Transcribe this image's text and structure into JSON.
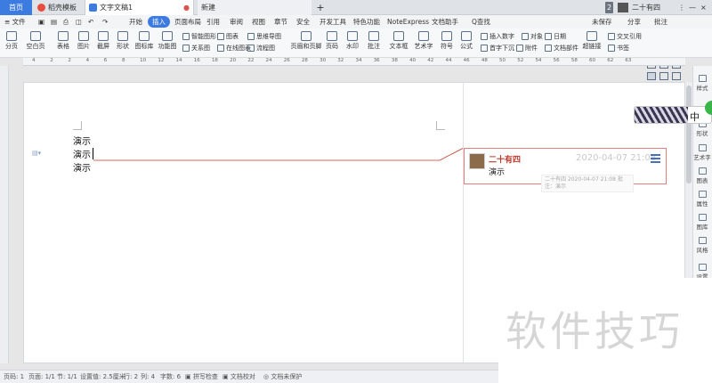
{
  "tabs": {
    "home": "首页",
    "docer": "稻壳模板",
    "doc": "文字文稿1",
    "new": "新建",
    "plus": "+"
  },
  "titlebar": {
    "badge": "2",
    "user": "二十有四"
  },
  "menu": {
    "file": "≡ 文件",
    "items": [
      "开始",
      "插入",
      "页面布局",
      "引用",
      "审阅",
      "视图",
      "章节",
      "安全",
      "开发工具",
      "特色功能",
      "NoteExpress",
      "文档助手"
    ],
    "search": "Q查找",
    "unsaved": "未保存",
    "share": "分享",
    "comment": "批注"
  },
  "ribbon": {
    "big": [
      "分页",
      "空白页",
      "表格",
      "图片",
      "截屏",
      "形状",
      "图标库",
      "功能图",
      "页眉和页脚",
      "页码",
      "水印",
      "批注",
      "文本框",
      "艺术字",
      "符号",
      "公式",
      "超链接",
      "书签"
    ],
    "small": [
      "智能图形",
      "图表",
      "思维导图",
      "关系图",
      "在线图表",
      "流程图",
      "插入数字",
      "对象",
      "日期",
      "首字下沉",
      "附件",
      "文档部件",
      "交叉引用"
    ]
  },
  "ruler": [
    "4",
    "2",
    "2",
    "4",
    "6",
    "8",
    "10",
    "12",
    "14",
    "16",
    "18",
    "20",
    "22",
    "24",
    "26",
    "28",
    "30",
    "32",
    "34",
    "36",
    "38",
    "40",
    "42",
    "44",
    "46",
    "48",
    "50",
    "52",
    "54",
    "56",
    "58",
    "60",
    "62",
    "63"
  ],
  "document": {
    "lines": [
      "演示",
      "演示",
      "演示"
    ]
  },
  "comment": {
    "author": "二十有四",
    "date": "2020-04-07 21:08",
    "text": "演示",
    "tooltip": "二十有四 2020-04-07 21:08 批注：演示"
  },
  "ime": {
    "char": "中"
  },
  "right_panel": [
    "样式",
    "形状",
    "艺术字",
    "图表",
    "属性",
    "图库",
    "风格",
    "设置"
  ],
  "watermark": "软件技巧",
  "status": {
    "page": "页码: 1",
    "pages": "页面: 1/1",
    "section": "节: 1/1",
    "setting": "设置值: 2.5厘米",
    "row": "行: 2",
    "col": "列: 4",
    "words": "字数: 6",
    "spell": "拼写检查",
    "proof": "文档校对",
    "protect": "文档未保护"
  }
}
